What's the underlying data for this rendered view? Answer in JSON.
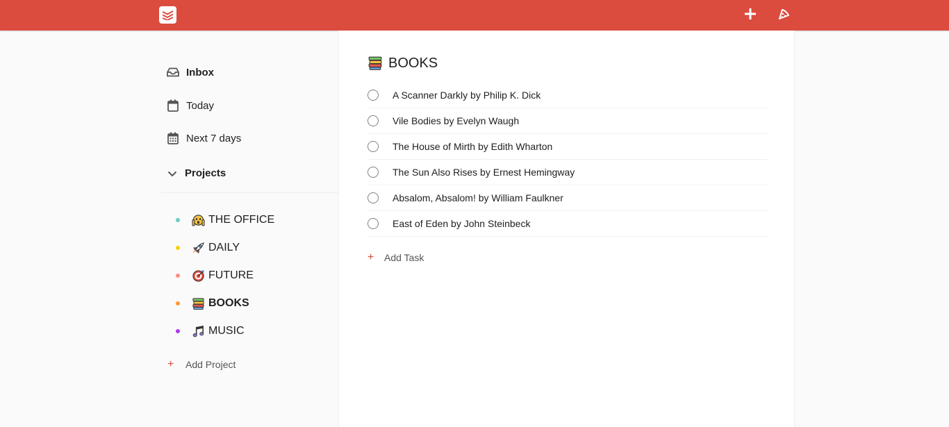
{
  "colors": {
    "brand": "#db4c3f",
    "teal": "#6accbc",
    "yellow": "#fad000",
    "salmon": "#ff8d85",
    "orange": "#ff9933",
    "purple": "#af38eb"
  },
  "topbar": {
    "logo_icon": "todoist-logo-icon",
    "add_icon": "plus-icon",
    "karma_icon": "pizza-icon"
  },
  "sidebar": {
    "nav": [
      {
        "label": "Inbox",
        "icon": "inbox-icon"
      },
      {
        "label": "Today",
        "icon": "calendar-icon"
      },
      {
        "label": "Next 7 days",
        "icon": "calendar-week-icon"
      }
    ],
    "projects_label": "Projects",
    "projects": [
      {
        "name": "THE OFFICE",
        "icon": "face-screaming-icon",
        "color": "#6accbc"
      },
      {
        "name": "DAILY",
        "icon": "rocket-icon",
        "color": "#fad000"
      },
      {
        "name": "FUTURE",
        "icon": "target-icon",
        "color": "#ff8d85"
      },
      {
        "name": "BOOKS",
        "icon": "books-icon",
        "color": "#ff9933"
      },
      {
        "name": "MUSIC",
        "icon": "music-note-icon",
        "color": "#af38eb"
      }
    ],
    "add_project_label": "Add Project",
    "add_project_symbol": "+"
  },
  "main": {
    "title": "BOOKS",
    "title_icon": "books-icon",
    "tasks": [
      "A Scanner Darkly by Philip K. Dick",
      "Vile Bodies by Evelyn Waugh",
      "The House of Mirth by Edith Wharton",
      "The Sun Also Rises by Ernest Hemingway",
      "Absalom, Absalom! by William Faulkner",
      "East of Eden by John Steinbeck"
    ],
    "add_task_label": "Add Task",
    "add_task_symbol": "+"
  }
}
